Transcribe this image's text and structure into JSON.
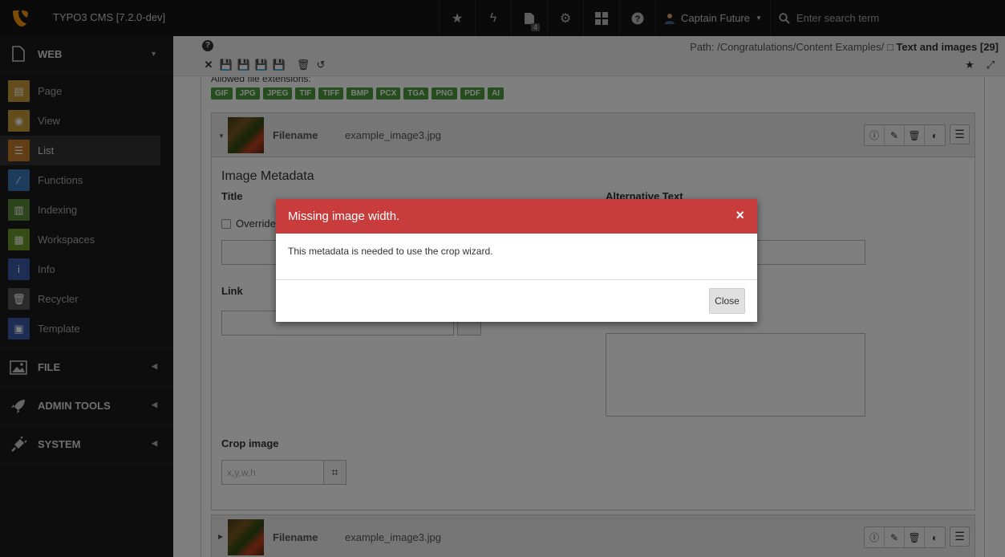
{
  "header": {
    "app_title": "TYPO3 CMS [7.2.0-dev]",
    "opendocs_count": "4",
    "user_name": "Captain Future",
    "search_placeholder": "Enter search term"
  },
  "sidebar": {
    "groups": [
      {
        "label": "WEB"
      },
      {
        "label": "FILE"
      },
      {
        "label": "ADMIN TOOLS"
      },
      {
        "label": "SYSTEM"
      }
    ],
    "items": [
      {
        "label": "Page",
        "color": "#c99a3a"
      },
      {
        "label": "View",
        "color": "#c99a3a"
      },
      {
        "label": "List",
        "color": "#c77a2a"
      },
      {
        "label": "Functions",
        "color": "#3a78b8"
      },
      {
        "label": "Indexing",
        "color": "#5a8a3a"
      },
      {
        "label": "Workspaces",
        "color": "#6a9a2a"
      },
      {
        "label": "Info",
        "color": "#3a5aa8"
      },
      {
        "label": "Recycler",
        "color": "#555555"
      },
      {
        "label": "Template",
        "color": "#3a5aa8"
      }
    ]
  },
  "docheader": {
    "path_prefix": "Path: /Congratulations/Content Examples/",
    "path_page": "Text and images [29]"
  },
  "form": {
    "allowed_label": "Allowed file extensions:",
    "extensions": [
      "GIF",
      "JPG",
      "JPEG",
      "TIF",
      "TIFF",
      "BMP",
      "PCX",
      "TGA",
      "PNG",
      "PDF",
      "AI"
    ],
    "filename_label": "Filename",
    "filename_value": "example_image3.jpg",
    "section_title": "Image Metadata",
    "title_label": "Title",
    "override_label": "Override",
    "alt_label": "Alternative Text",
    "link_label": "Link",
    "crop_label": "Crop image",
    "crop_placeholder": "x,y,w,h"
  },
  "modal": {
    "title": "Missing image width.",
    "message": "This metadata is needed to use the crop wizard.",
    "close_label": "Close"
  }
}
